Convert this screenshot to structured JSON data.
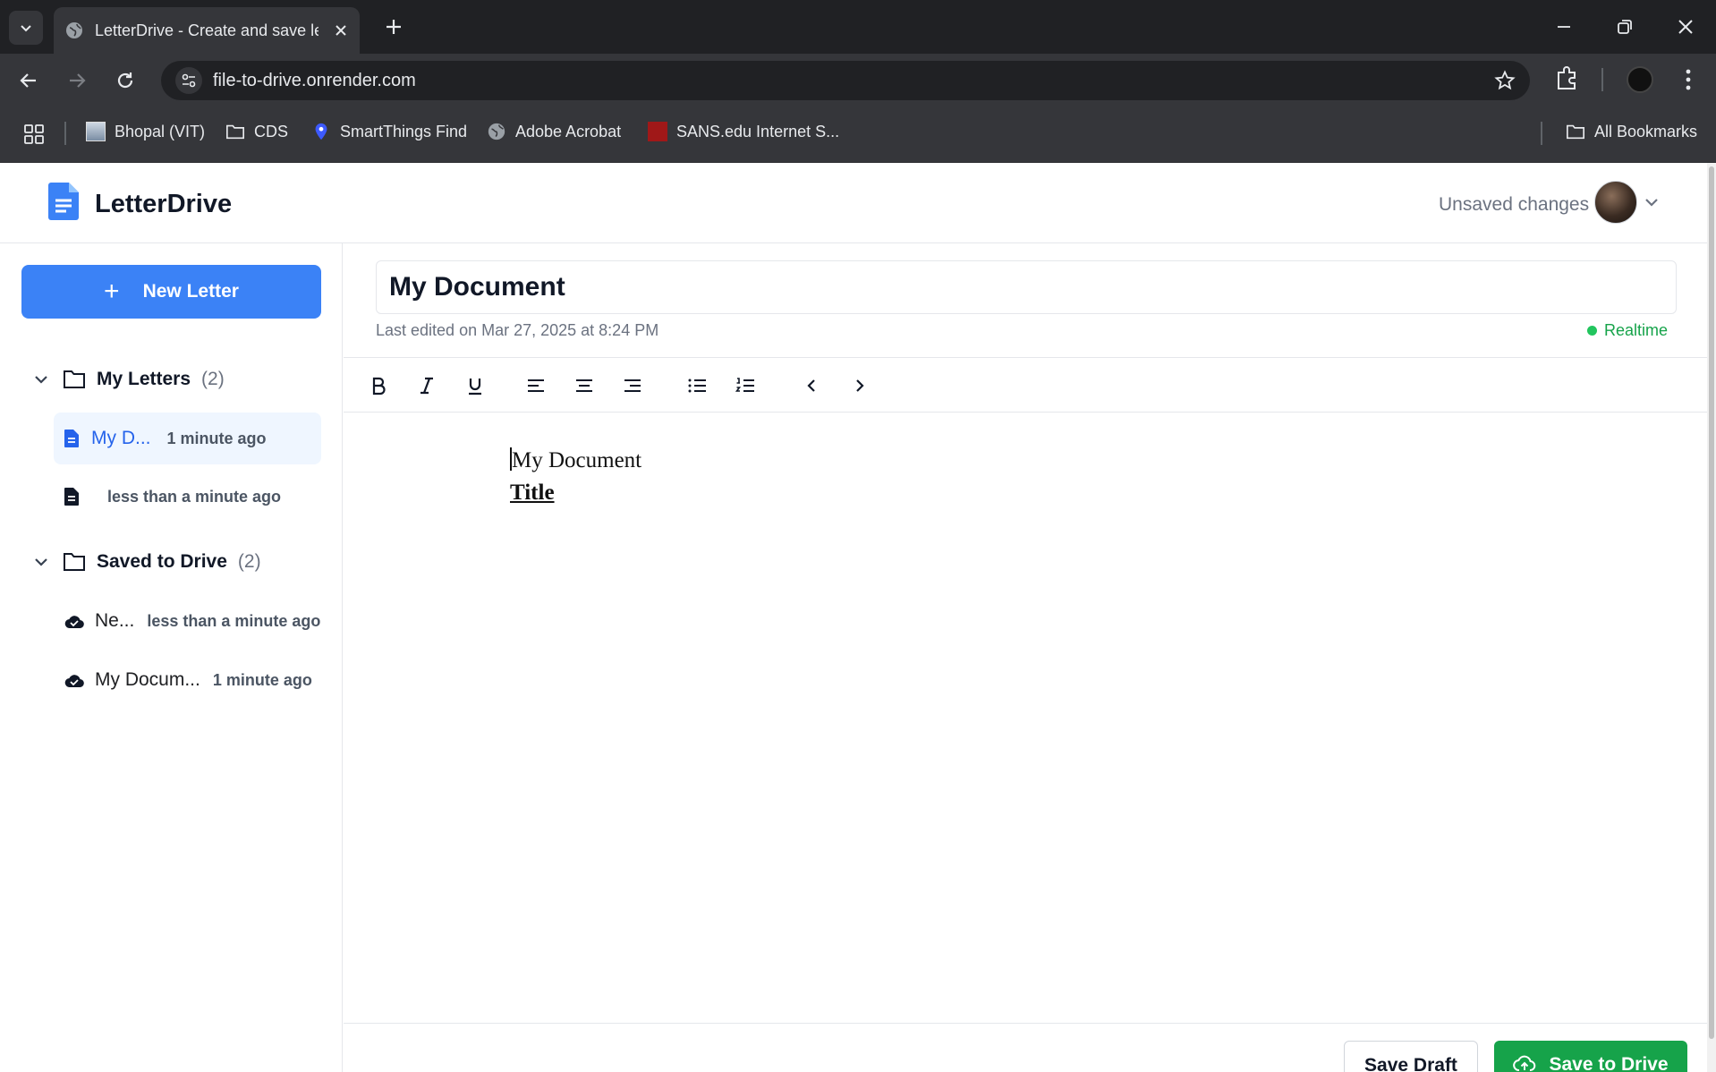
{
  "browser": {
    "tab_title": "LetterDrive - Create and save le",
    "url": "file-to-drive.onrender.com",
    "bookmarks": [
      {
        "label": "Bhopal (VIT)",
        "icon": "site-favicon"
      },
      {
        "label": "CDS",
        "icon": "folder-icon"
      },
      {
        "label": "SmartThings Find",
        "icon": "location-pin-icon"
      },
      {
        "label": "Adobe Acrobat",
        "icon": "globe-icon"
      },
      {
        "label": "SANS.edu Internet S...",
        "icon": "site-favicon"
      }
    ],
    "all_bookmarks": "All Bookmarks"
  },
  "app": {
    "name": "LetterDrive",
    "status": "Unsaved changes",
    "new_letter_label": "New Letter",
    "folders": [
      {
        "name": "My Letters",
        "count": "(2)",
        "files": [
          {
            "name": "My D...",
            "time": "1 minute ago",
            "icon": "document-icon",
            "active": true
          },
          {
            "name": "",
            "time": "less than a minute ago",
            "icon": "document-icon",
            "active": false
          }
        ]
      },
      {
        "name": "Saved to Drive",
        "count": "(2)",
        "files": [
          {
            "name": "Ne...",
            "time": "less than a minute ago",
            "icon": "cloud-check-icon",
            "active": false
          },
          {
            "name": "My Docum...",
            "time": "1 minute ago",
            "icon": "cloud-check-icon",
            "active": false
          }
        ]
      }
    ]
  },
  "editor": {
    "title_value": "My Document",
    "last_edited": "Last edited on Mar 27, 2025 at 8:24 PM",
    "realtime_label": "Realtime",
    "toolbar": [
      "bold-icon",
      "italic-icon",
      "underline-icon",
      "align-left-icon",
      "align-center-icon",
      "align-right-icon",
      "bullet-list-icon",
      "numbered-list-icon",
      "undo-icon",
      "redo-icon"
    ],
    "body_line1": "My Document",
    "body_line2": "Title",
    "save_draft_label": "Save Draft",
    "save_drive_label": "Save to Drive"
  },
  "colors": {
    "primary": "#3b82f6",
    "success": "#16a34a",
    "active_bg": "#eff6ff"
  }
}
